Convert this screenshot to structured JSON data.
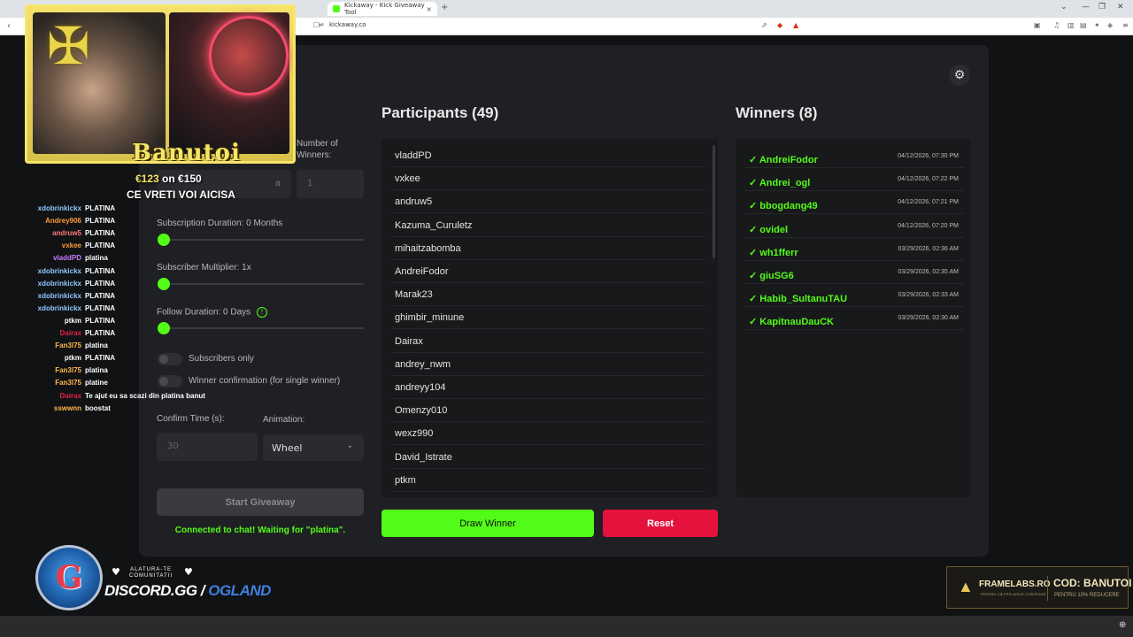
{
  "browser": {
    "active_tab_title": "Kickaway - Kick Giveaway Tool",
    "tab_close": "×",
    "new_tab": "+",
    "url": "kickaway.co",
    "icons": [
      "back-icon",
      "reload-icon",
      "bookmark-icon",
      "share-icon",
      "brave-shield-icon",
      "extension-icon"
    ],
    "nav": {
      "back": "‹",
      "reload": "⟳"
    },
    "window_controls": {
      "minimize": "—",
      "restore": "❐",
      "close": "✕",
      "dropdown": "⌄"
    }
  },
  "app": {
    "settings_icon": "⚙",
    "settings": {
      "keyword_value_partial": "a",
      "number_of_winners_label": "Number of\nWinners:",
      "number_of_winners_value": "1",
      "subscription_duration_label": "Subscription Duration: 0 Months",
      "subscriber_multiplier_label": "Subscriber Multiplier: 1x",
      "follow_duration_label": "Follow Duration:  0  Days",
      "follow_info_icon": "!",
      "subscribers_only_label": "Subscribers only",
      "winner_confirmation_label": "Winner confirmation (for single winner)",
      "confirm_time_label": "Confirm Time (s):",
      "confirm_time_placeholder": "30",
      "animation_label": "Animation:",
      "animation_value": "Wheel",
      "animation_chevron": "⌄",
      "start_button": "Start Giveaway",
      "status": "Connected to chat! Waiting for \"platina\"."
    },
    "participants": {
      "title": "Participants (49)",
      "items": [
        "vladdPD",
        "vxkee",
        "andruw5",
        "Kazuma_Curuletz",
        "mihaitzabomba",
        "AndreiFodor",
        "Marak23",
        "ghimbir_minune",
        "Dairax",
        "andrey_nwm",
        "andreyy104",
        "Omenzy010",
        "wexz990",
        "David_Istrate",
        "ptkm"
      ]
    },
    "winners": {
      "title": "Winners (8)",
      "items": [
        {
          "name": "✓ AndreiFodor",
          "time": "04/12/2026, 07:30 PM"
        },
        {
          "name": "✓ Andrei_ogl",
          "time": "04/12/2026, 07:22 PM"
        },
        {
          "name": "✓ bbogdang49",
          "time": "04/12/2026, 07:21 PM"
        },
        {
          "name": "✓ ovidel",
          "time": "04/12/2026, 07:20 PM"
        },
        {
          "name": "✓ wh1fferr",
          "time": "03/29/2026, 02:36 AM"
        },
        {
          "name": "✓ giuSG6",
          "time": "03/29/2026, 02:35 AM"
        },
        {
          "name": "✓ Habib_SultanuTAU",
          "time": "03/29/2026, 02:33 AM"
        },
        {
          "name": "✓ KapitnauDauCK",
          "time": "03/29/2026, 02:30 AM"
        }
      ]
    },
    "draw_button": "Draw Winner",
    "reset_button": "Reset",
    "colors": {
      "accent": "#53fc18",
      "danger": "#e4123c",
      "card": "#1f2023",
      "background": "#111214"
    }
  },
  "stream_overlay": {
    "streamer_name": "Banutoi",
    "goal_current": "€123",
    "goal_rest": " on €150",
    "goal_subtitle": "CE VRETI VOI AICISA",
    "chat": [
      {
        "user": "xdobrinkickx",
        "color": "#8ec8ff",
        "msg": "PLATINA"
      },
      {
        "user": "Andrey906",
        "color": "#ff9a3a",
        "msg": "PLATINA"
      },
      {
        "user": "andruw5",
        "color": "#ff7a7a",
        "msg": "PLATINA"
      },
      {
        "user": "vxkee",
        "color": "#ff9a3a",
        "msg": "PLATINA"
      },
      {
        "user": "vladdPD",
        "color": "#c77dff",
        "msg": "platina"
      },
      {
        "user": "xdobrinkickx",
        "color": "#8ec8ff",
        "msg": "PLATINA"
      },
      {
        "user": "xdobrinkickx",
        "color": "#8ec8ff",
        "msg": "PLATINA"
      },
      {
        "user": "xdobrinkickx",
        "color": "#8ec8ff",
        "msg": "PLATINA"
      },
      {
        "user": "xdobrinkickx",
        "color": "#8ec8ff",
        "msg": "PLATINA"
      },
      {
        "user": "ptkm",
        "color": "#ffffff",
        "msg": "PLATINA"
      },
      {
        "user": "Dairax",
        "color": "#e0224a",
        "msg": "PLATINA"
      },
      {
        "user": "Fan3l75",
        "color": "#ffb84a",
        "msg": "platina"
      },
      {
        "user": "ptkm",
        "color": "#ffffff",
        "msg": "PLATINA"
      },
      {
        "user": "Fan3l75",
        "color": "#ffb84a",
        "msg": "platina"
      },
      {
        "user": "Fan3l75",
        "color": "#ffb84a",
        "msg": "platine"
      },
      {
        "user": "Dairax",
        "color": "#e0224a",
        "msg": "Te ajut eu sa scazi din platina banut"
      },
      {
        "user": "sswwnn",
        "color": "#ffb84a",
        "msg": "boostat"
      }
    ],
    "discord": {
      "badge_letter": "G",
      "invite_line1": "ALATURA-TE",
      "invite_line2": "COMUNITATII",
      "heart": "♥",
      "url_prefix": "DISCORD.GG",
      "url_suffix": "OGLAND"
    },
    "promo": {
      "brand": "FRAMELABS.RO",
      "brand_sub": "PENTRU CĂ FPS-URILE CONTEAZĂ",
      "code": "COD: BANUTOI",
      "code_sub": "PENTRU 10% REDUCERE",
      "flame": "🔥"
    }
  }
}
